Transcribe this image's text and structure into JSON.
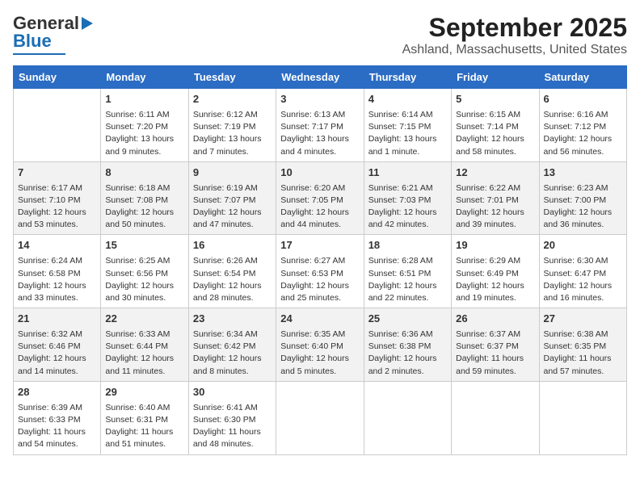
{
  "logo": {
    "line1": "General",
    "line2": "Blue"
  },
  "title": "September 2025",
  "subtitle": "Ashland, Massachusetts, United States",
  "headers": [
    "Sunday",
    "Monday",
    "Tuesday",
    "Wednesday",
    "Thursday",
    "Friday",
    "Saturday"
  ],
  "weeks": [
    [
      {
        "day": "",
        "info": ""
      },
      {
        "day": "1",
        "info": "Sunrise: 6:11 AM\nSunset: 7:20 PM\nDaylight: 13 hours\nand 9 minutes."
      },
      {
        "day": "2",
        "info": "Sunrise: 6:12 AM\nSunset: 7:19 PM\nDaylight: 13 hours\nand 7 minutes."
      },
      {
        "day": "3",
        "info": "Sunrise: 6:13 AM\nSunset: 7:17 PM\nDaylight: 13 hours\nand 4 minutes."
      },
      {
        "day": "4",
        "info": "Sunrise: 6:14 AM\nSunset: 7:15 PM\nDaylight: 13 hours\nand 1 minute."
      },
      {
        "day": "5",
        "info": "Sunrise: 6:15 AM\nSunset: 7:14 PM\nDaylight: 12 hours\nand 58 minutes."
      },
      {
        "day": "6",
        "info": "Sunrise: 6:16 AM\nSunset: 7:12 PM\nDaylight: 12 hours\nand 56 minutes."
      }
    ],
    [
      {
        "day": "7",
        "info": "Sunrise: 6:17 AM\nSunset: 7:10 PM\nDaylight: 12 hours\nand 53 minutes."
      },
      {
        "day": "8",
        "info": "Sunrise: 6:18 AM\nSunset: 7:08 PM\nDaylight: 12 hours\nand 50 minutes."
      },
      {
        "day": "9",
        "info": "Sunrise: 6:19 AM\nSunset: 7:07 PM\nDaylight: 12 hours\nand 47 minutes."
      },
      {
        "day": "10",
        "info": "Sunrise: 6:20 AM\nSunset: 7:05 PM\nDaylight: 12 hours\nand 44 minutes."
      },
      {
        "day": "11",
        "info": "Sunrise: 6:21 AM\nSunset: 7:03 PM\nDaylight: 12 hours\nand 42 minutes."
      },
      {
        "day": "12",
        "info": "Sunrise: 6:22 AM\nSunset: 7:01 PM\nDaylight: 12 hours\nand 39 minutes."
      },
      {
        "day": "13",
        "info": "Sunrise: 6:23 AM\nSunset: 7:00 PM\nDaylight: 12 hours\nand 36 minutes."
      }
    ],
    [
      {
        "day": "14",
        "info": "Sunrise: 6:24 AM\nSunset: 6:58 PM\nDaylight: 12 hours\nand 33 minutes."
      },
      {
        "day": "15",
        "info": "Sunrise: 6:25 AM\nSunset: 6:56 PM\nDaylight: 12 hours\nand 30 minutes."
      },
      {
        "day": "16",
        "info": "Sunrise: 6:26 AM\nSunset: 6:54 PM\nDaylight: 12 hours\nand 28 minutes."
      },
      {
        "day": "17",
        "info": "Sunrise: 6:27 AM\nSunset: 6:53 PM\nDaylight: 12 hours\nand 25 minutes."
      },
      {
        "day": "18",
        "info": "Sunrise: 6:28 AM\nSunset: 6:51 PM\nDaylight: 12 hours\nand 22 minutes."
      },
      {
        "day": "19",
        "info": "Sunrise: 6:29 AM\nSunset: 6:49 PM\nDaylight: 12 hours\nand 19 minutes."
      },
      {
        "day": "20",
        "info": "Sunrise: 6:30 AM\nSunset: 6:47 PM\nDaylight: 12 hours\nand 16 minutes."
      }
    ],
    [
      {
        "day": "21",
        "info": "Sunrise: 6:32 AM\nSunset: 6:46 PM\nDaylight: 12 hours\nand 14 minutes."
      },
      {
        "day": "22",
        "info": "Sunrise: 6:33 AM\nSunset: 6:44 PM\nDaylight: 12 hours\nand 11 minutes."
      },
      {
        "day": "23",
        "info": "Sunrise: 6:34 AM\nSunset: 6:42 PM\nDaylight: 12 hours\nand 8 minutes."
      },
      {
        "day": "24",
        "info": "Sunrise: 6:35 AM\nSunset: 6:40 PM\nDaylight: 12 hours\nand 5 minutes."
      },
      {
        "day": "25",
        "info": "Sunrise: 6:36 AM\nSunset: 6:38 PM\nDaylight: 12 hours\nand 2 minutes."
      },
      {
        "day": "26",
        "info": "Sunrise: 6:37 AM\nSunset: 6:37 PM\nDaylight: 11 hours\nand 59 minutes."
      },
      {
        "day": "27",
        "info": "Sunrise: 6:38 AM\nSunset: 6:35 PM\nDaylight: 11 hours\nand 57 minutes."
      }
    ],
    [
      {
        "day": "28",
        "info": "Sunrise: 6:39 AM\nSunset: 6:33 PM\nDaylight: 11 hours\nand 54 minutes."
      },
      {
        "day": "29",
        "info": "Sunrise: 6:40 AM\nSunset: 6:31 PM\nDaylight: 11 hours\nand 51 minutes."
      },
      {
        "day": "30",
        "info": "Sunrise: 6:41 AM\nSunset: 6:30 PM\nDaylight: 11 hours\nand 48 minutes."
      },
      {
        "day": "",
        "info": ""
      },
      {
        "day": "",
        "info": ""
      },
      {
        "day": "",
        "info": ""
      },
      {
        "day": "",
        "info": ""
      }
    ]
  ]
}
